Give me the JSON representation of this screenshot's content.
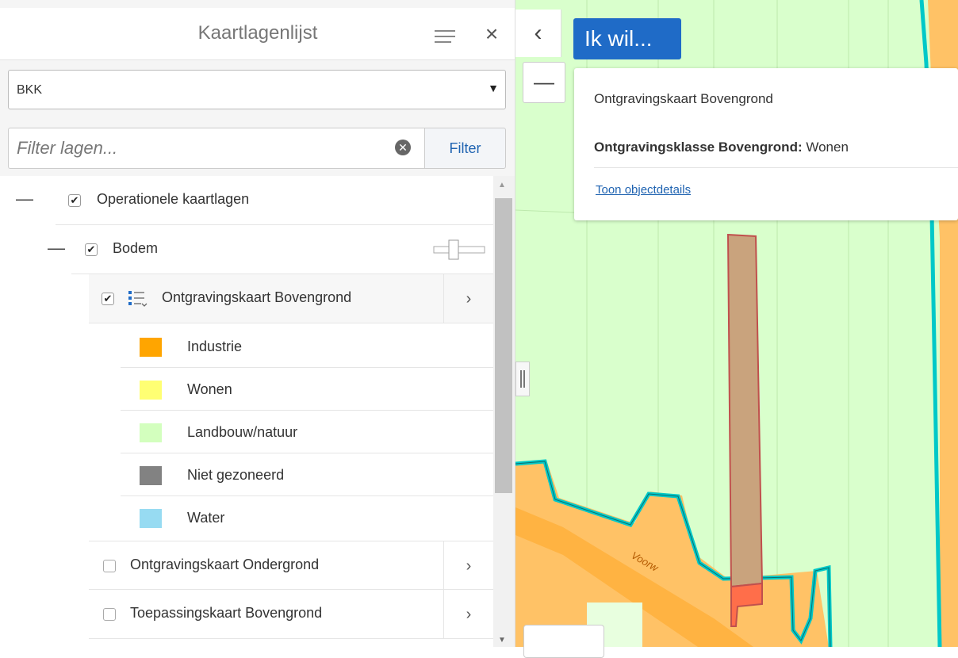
{
  "panel": {
    "title": "Kaartlagenlijst",
    "close_glyph": "×",
    "dropdown_value": "BKK",
    "dropdown_caret": "▼",
    "filter_placeholder": "Filter lagen...",
    "clear_glyph": "✕",
    "filter_button": "Filter"
  },
  "tree": {
    "root": {
      "label": "Operationele kaartlagen",
      "checked": true,
      "collapse": "—"
    },
    "group": {
      "label": "Bodem",
      "checked": true,
      "collapse": "—"
    },
    "layers": [
      {
        "label": "Ontgravingskaart Bovengrond",
        "checked": true,
        "chevron": "›"
      },
      {
        "label": "Ontgravingskaart Ondergrond",
        "checked": false,
        "chevron": "›"
      },
      {
        "label": "Toepassingskaart Bovengrond",
        "checked": false,
        "chevron": "›"
      }
    ],
    "legend": [
      {
        "label": "Industrie",
        "color": "#ffa500"
      },
      {
        "label": "Wonen",
        "color": "#ffff73"
      },
      {
        "label": "Landbouw/natuur",
        "color": "#d3ffbe"
      },
      {
        "label": "Niet gezoneerd",
        "color": "#828282"
      },
      {
        "label": "Water",
        "color": "#97dbf2"
      }
    ],
    "check_glyph": "✔"
  },
  "map": {
    "back_glyph": "‹",
    "zoom_out_glyph": "—",
    "ik_wil": "Ik wil...",
    "street_label": "Voorw"
  },
  "popup": {
    "title": "Ontgravingskaart Bovengrond",
    "attr_key": "Ontgravingsklasse Bovengrond:",
    "attr_value": "Wonen",
    "link": "Toon objectdetails"
  }
}
